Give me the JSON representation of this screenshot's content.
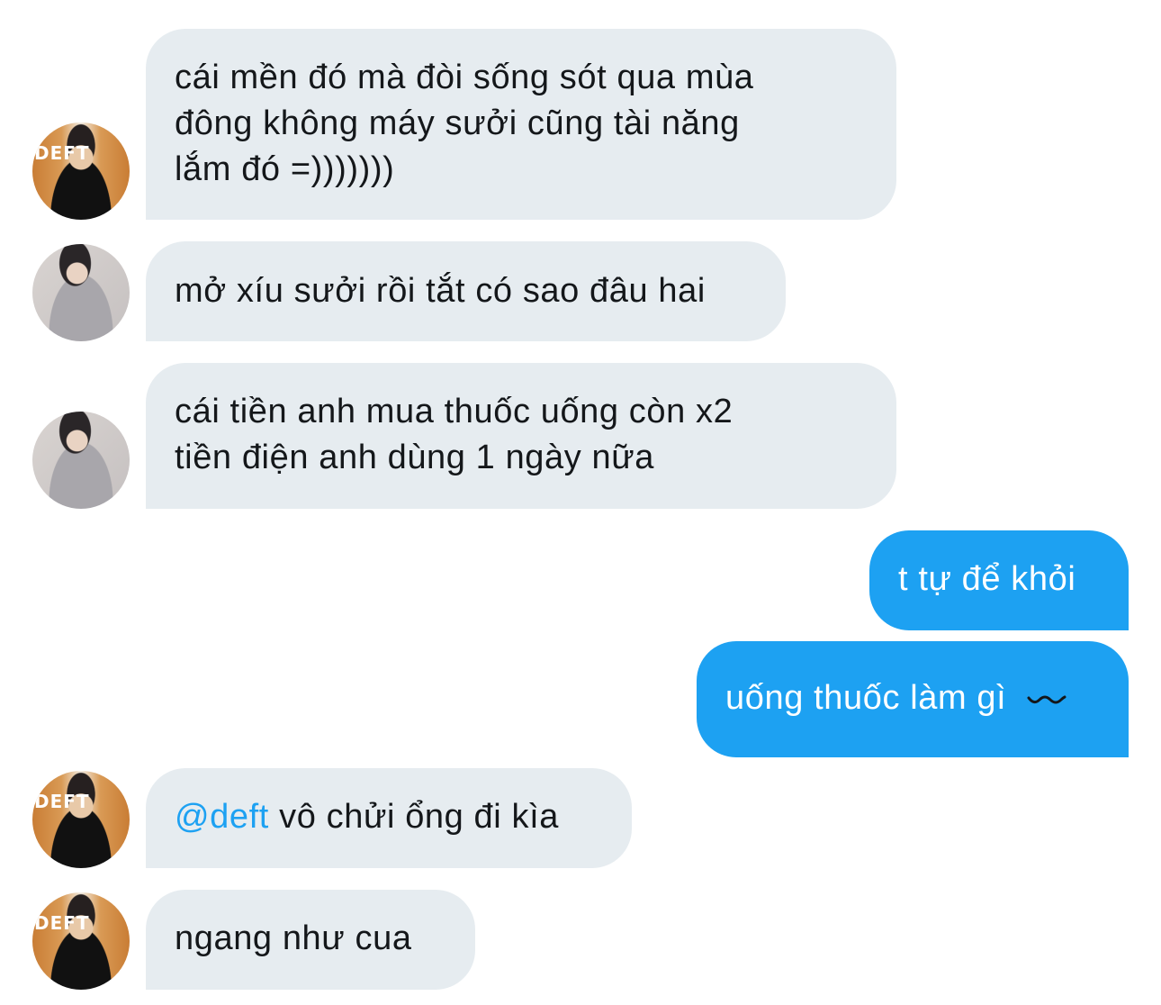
{
  "conversation": {
    "messages": [
      {
        "direction": "incoming",
        "avatar": "deft-jersey-avatar",
        "lines": [
          "cái mền đó mà đòi sống sót qua mùa",
          "đông không máy sưởi cũng tài năng",
          "lắm đó =)))))))"
        ]
      },
      {
        "direction": "incoming",
        "avatar": "grey-hoodie-avatar",
        "lines": [
          "mở xíu sưởi rồi tắt có sao đâu hai"
        ]
      },
      {
        "direction": "incoming",
        "avatar": "grey-hoodie-avatar",
        "lines": [
          "cái tiền anh mua thuốc uống còn x2",
          "tiền điện anh dùng 1 ngày nữa"
        ]
      },
      {
        "direction": "outgoing",
        "lines": [
          "t tự để khỏi"
        ]
      },
      {
        "direction": "outgoing",
        "lines": [
          "uống thuốc làm gì"
        ],
        "trailing_icon": "wavy-line-icon"
      },
      {
        "direction": "incoming",
        "avatar": "deft-jersey-avatar",
        "mention": "@deft",
        "lines": [
          " vô chửi ổng đi kìa"
        ]
      },
      {
        "direction": "incoming",
        "avatar": "deft-jersey-avatar",
        "lines": [
          "ngang như cua"
        ]
      }
    ]
  },
  "avatar_label": "DEFT",
  "colors": {
    "incoming_bubble": "#e6ecf0",
    "outgoing_bubble": "#1da1f2",
    "mention": "#1da1f2",
    "text_dark": "#14171a",
    "text_light": "#ffffff"
  }
}
